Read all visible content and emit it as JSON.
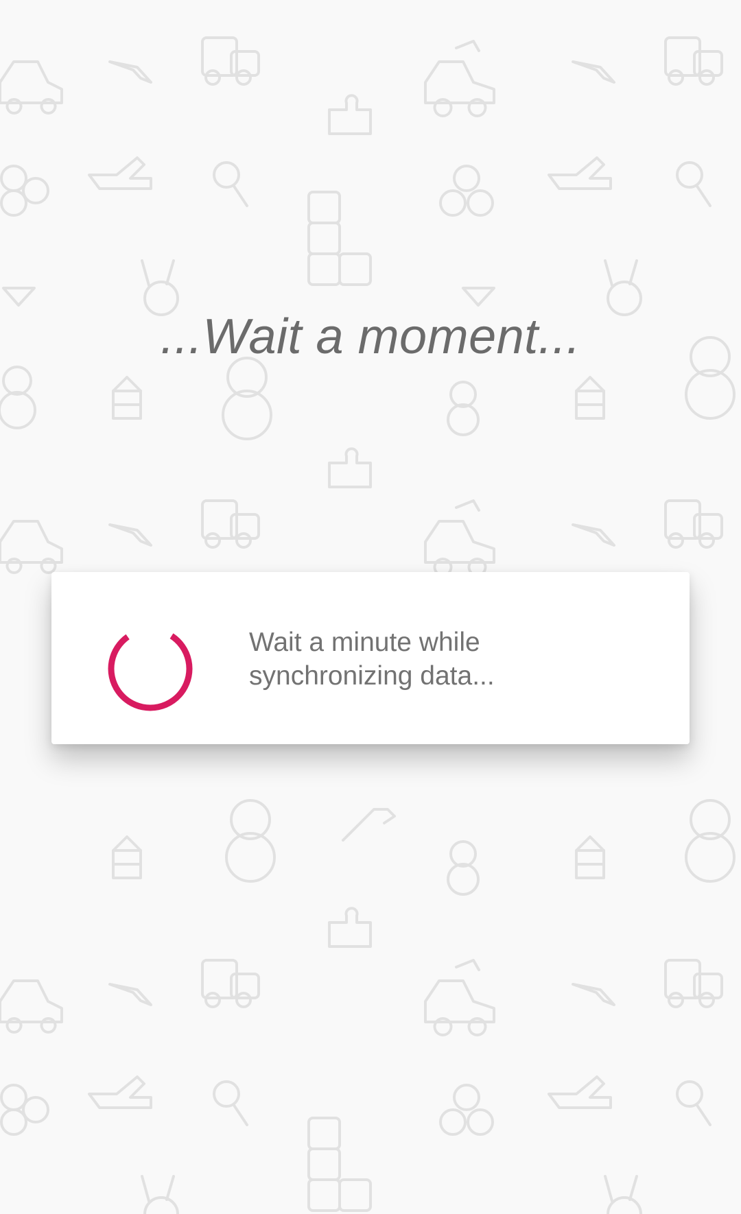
{
  "screen": {
    "title": "...Wait a moment..."
  },
  "dialog": {
    "message_line_1": "Wait a minute while",
    "message_line_2": "synchronizing data..."
  },
  "colors": {
    "background": "#f8f8f8",
    "pattern": "#d7d7d7",
    "title_text": "#6b6b6b",
    "message_text": "#727272",
    "spinner_accent": "#d81b60"
  },
  "icons": [
    "toy-car-icon",
    "boomerang-icon",
    "toy-train-icon",
    "puzzle-icon",
    "fidget-spinner-icon",
    "toy-plane-icon",
    "rattle-icon",
    "abc-blocks-icon",
    "bunny-icon",
    "spinning-top-icon",
    "teddy-bear-icon",
    "stacking-blocks-icon",
    "hobby-horse-icon",
    "loading-spinner-icon"
  ]
}
